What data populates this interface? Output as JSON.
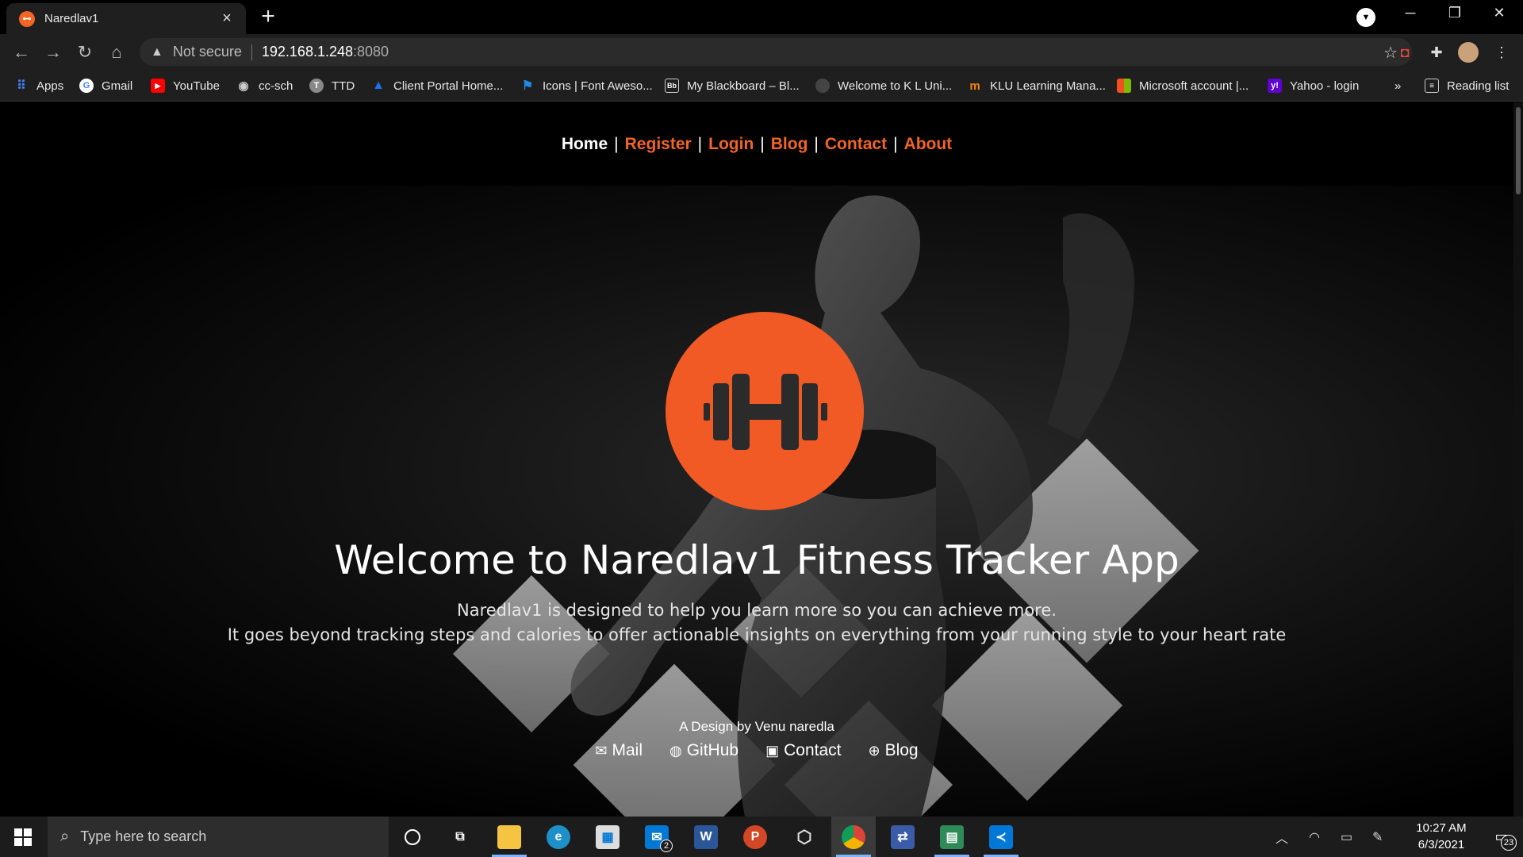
{
  "browser": {
    "tab_title": "Naredlav1",
    "omnibox": {
      "security_label": "Not secure",
      "host": "192.168.1.248",
      "port": ":8080"
    },
    "bookmarks": [
      {
        "label": "Apps",
        "icon": "apps-grid-icon",
        "color": "#4285f4"
      },
      {
        "label": "Gmail",
        "icon": "google-icon",
        "color": "#ffffff"
      },
      {
        "label": "YouTube",
        "icon": "youtube-icon",
        "color": "#ff0000"
      },
      {
        "label": "cc-sch",
        "icon": "globe-icon",
        "color": "#cccccc"
      },
      {
        "label": "TTD",
        "icon": "ttd-icon",
        "color": "#888888"
      },
      {
        "label": "Client Portal Home...",
        "icon": "triangle-icon",
        "color": "#1a73e8"
      },
      {
        "label": "Icons | Font Aweso...",
        "icon": "flag-icon",
        "color": "#228ae6"
      },
      {
        "label": "My Blackboard – Bl...",
        "icon": "blackboard-icon",
        "color": "#333333"
      },
      {
        "label": "Welcome to K L Uni...",
        "icon": "klu-icon",
        "color": "#444444"
      },
      {
        "label": "KLU Learning Mana...",
        "icon": "moodle-icon",
        "color": "#f98012"
      },
      {
        "label": "Microsoft account |...",
        "icon": "microsoft-icon",
        "color": "#f25022"
      },
      {
        "label": "Yahoo - login",
        "icon": "yahoo-icon",
        "color": "#6001d2"
      }
    ],
    "more_bookmarks": "»",
    "reading_list": "Reading list"
  },
  "site": {
    "nav": [
      {
        "label": "Home",
        "active": true
      },
      {
        "label": "Register",
        "active": false
      },
      {
        "label": "Login",
        "active": false
      },
      {
        "label": "Blog",
        "active": false
      },
      {
        "label": "Contact",
        "active": false
      },
      {
        "label": "About",
        "active": false
      }
    ],
    "nav_separator": "|",
    "logo_icon": "dumbbell-icon",
    "welcome": "Welcome to Naredlav1 Fitness Tracker App",
    "tagline_1": "Naredlav1 is designed to help you learn more so you can achieve more.",
    "tagline_2": "It goes beyond tracking steps and calories to offer actionable insights on everything from your running style to your heart rate",
    "credit": "A Design by Venu naredla",
    "social": [
      {
        "label": "Mail",
        "icon": "envelope-icon"
      },
      {
        "label": "GitHub",
        "icon": "github-icon"
      },
      {
        "label": "Contact",
        "icon": "contact-card-icon"
      },
      {
        "label": "Blog",
        "icon": "globe-icon"
      }
    ],
    "colors": {
      "accent": "#f26522",
      "logo": "#f15a24"
    }
  },
  "taskbar": {
    "search_placeholder": "Type here to search",
    "mail_badge": "2",
    "time": "10:27 AM",
    "date": "6/3/2021",
    "notification_count": "23"
  }
}
